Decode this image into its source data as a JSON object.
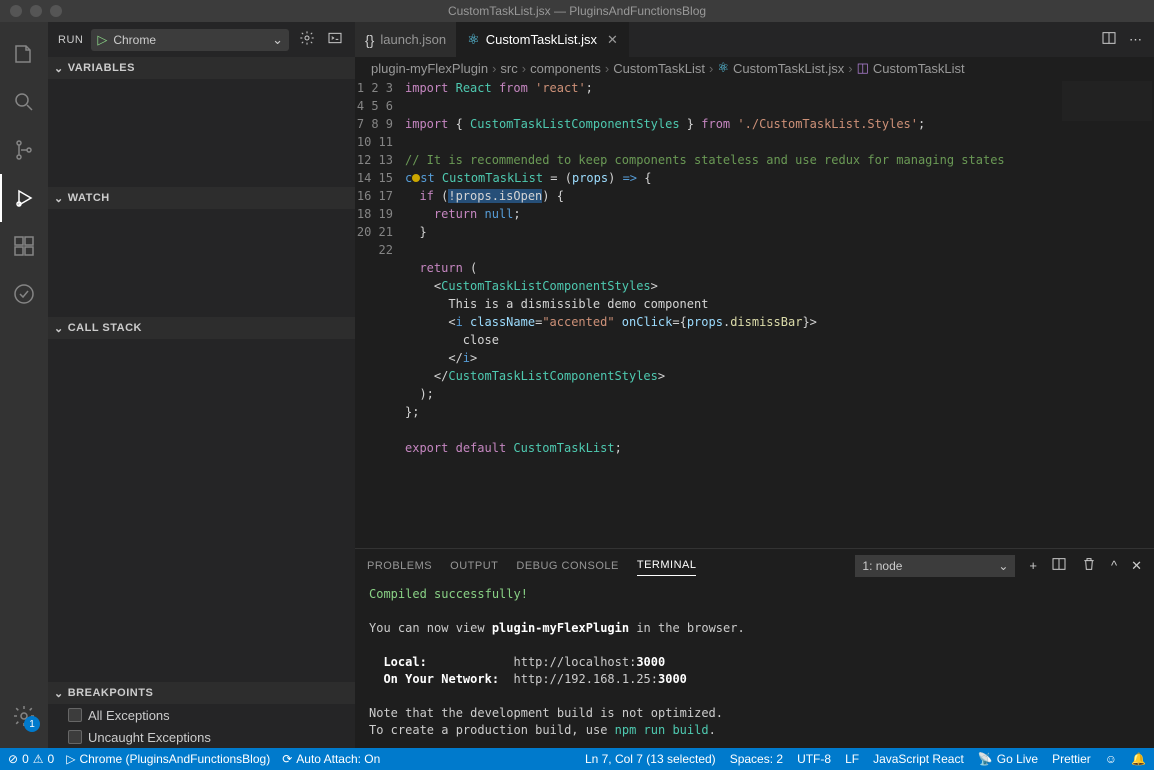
{
  "titlebar": {
    "title": "CustomTaskList.jsx — PluginsAndFunctionsBlog"
  },
  "run": {
    "label": "RUN",
    "config": "Chrome"
  },
  "sidebar": {
    "sections": {
      "variables": "VARIABLES",
      "watch": "WATCH",
      "callstack": "CALL STACK",
      "breakpoints": "BREAKPOINTS"
    },
    "breakpoints": [
      {
        "label": "All Exceptions"
      },
      {
        "label": "Uncaught Exceptions"
      }
    ]
  },
  "tabs": [
    {
      "icon": "{}",
      "label": "launch.json",
      "active": false,
      "iconColor": "#cccccc"
    },
    {
      "icon": "⚛",
      "label": "CustomTaskList.jsx",
      "active": true,
      "iconColor": "#61dafb"
    }
  ],
  "breadcrumbs": [
    {
      "label": "plugin-myFlexPlugin"
    },
    {
      "label": "src"
    },
    {
      "label": "components"
    },
    {
      "label": "CustomTaskList"
    },
    {
      "label": "CustomTaskList.jsx",
      "icon": "⚛"
    },
    {
      "label": "CustomTaskList",
      "icon": "[⊘]"
    }
  ],
  "code": {
    "lines": 22
  },
  "panel": {
    "tabs": [
      "PROBLEMS",
      "OUTPUT",
      "DEBUG CONSOLE",
      "TERMINAL"
    ],
    "activeTab": 3,
    "terminalSelect": "1: node",
    "terminal": {
      "line1": "Compiled successfully!",
      "line2a": "You can now view ",
      "line2b": "plugin-myFlexPlugin",
      "line2c": " in the browser.",
      "localLabel": "  Local:",
      "localUrl": "http://localhost:",
      "localPort": "3000",
      "netLabel": "  On Your Network:",
      "netUrl": "http://192.168.1.25:",
      "netPort": "3000",
      "note1": "Note that the development build is not optimized.",
      "note2a": "To create a production build, use ",
      "note2b": "npm run build",
      "note2c": "."
    }
  },
  "statusbar": {
    "errors": "0",
    "warnings": "0",
    "launch": "Chrome (PluginsAndFunctionsBlog)",
    "autoattach": "Auto Attach: On",
    "pos": "Ln 7, Col 7 (13 selected)",
    "spaces": "Spaces: 2",
    "encoding": "UTF-8",
    "eol": "LF",
    "lang": "JavaScript React",
    "golive": "Go Live",
    "prettier": "Prettier"
  },
  "settingsBadge": "1"
}
